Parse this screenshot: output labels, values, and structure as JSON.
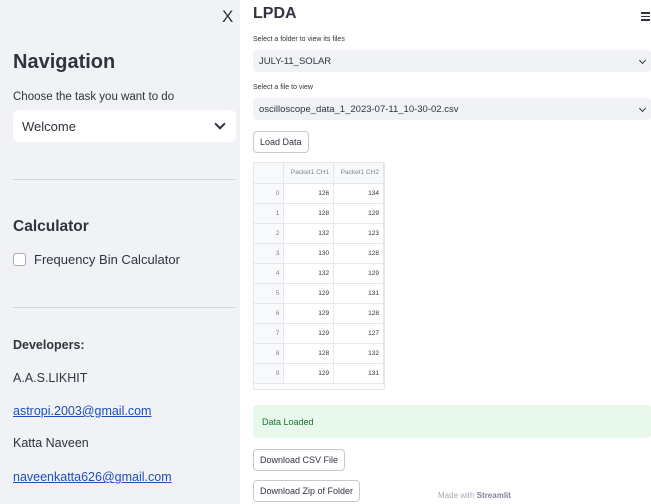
{
  "sidebar": {
    "close_label": "X",
    "nav_title": "Navigation",
    "nav_caption": "Choose the task you want to do",
    "nav_select_value": "Welcome",
    "calc_title": "Calculator",
    "checkbox_label": "Frequency Bin Calculator",
    "checkbox_checked": false,
    "dev_title": "Developers:",
    "dev1_name": "A.A.S.LIKHIT",
    "dev1_email": "astropi.2003@gmail.com",
    "dev2_name": "Katta Naveen",
    "dev2_email": "naveenkatta626@gmail.com"
  },
  "main": {
    "title": "LPDA",
    "folder_label": "Select a folder to view its files",
    "folder_value": "JULY-11_SOLAR",
    "file_label": "Select a file to view",
    "file_value": "oscilloscope_data_1_2023-07-11_10-30-02.csv",
    "load_button": "Load Data",
    "table": {
      "columns": [
        "",
        "Packet1 CH1",
        "Packet1 CH2"
      ],
      "rows": [
        [
          "0",
          "126",
          "134"
        ],
        [
          "1",
          "128",
          "129"
        ],
        [
          "2",
          "132",
          "123"
        ],
        [
          "3",
          "130",
          "128"
        ],
        [
          "4",
          "132",
          "129"
        ],
        [
          "5",
          "129",
          "131"
        ],
        [
          "6",
          "129",
          "128"
        ],
        [
          "7",
          "129",
          "127"
        ],
        [
          "8",
          "128",
          "132"
        ],
        [
          "9",
          "129",
          "131"
        ]
      ]
    },
    "success_text": "Data Loaded",
    "download_csv": "Download CSV File",
    "download_zip": "Download Zip of Folder"
  },
  "footer": {
    "prefix": "Made with ",
    "brand": "Streamlit"
  },
  "colors": {
    "sidebar_bg": "#f0f2f6",
    "success_bg": "#e8f8ea",
    "success_text": "#177233",
    "link": "#1c4fb8"
  },
  "icons": {
    "close": "close-icon",
    "menu": "hamburger-menu-icon",
    "dropdown": "chevron-down-icon"
  }
}
